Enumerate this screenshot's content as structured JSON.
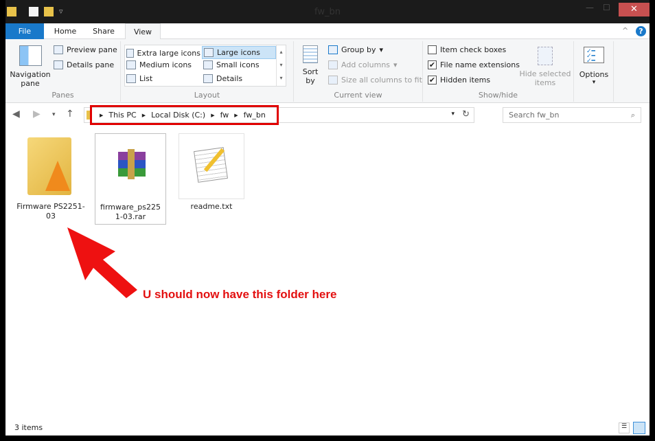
{
  "window": {
    "title": "fw_bn",
    "close": "✕",
    "minimize": "—",
    "maximize": "☐"
  },
  "tabs": [
    "File",
    "Home",
    "Share",
    "View"
  ],
  "ribbon": {
    "panes": {
      "label": "Panes",
      "navigation_pane": "Navigation pane",
      "preview_pane": "Preview pane",
      "details_pane": "Details pane"
    },
    "layout": {
      "label": "Layout",
      "items": [
        "Extra large icons",
        "Large icons",
        "Medium icons",
        "Small icons",
        "List",
        "Details"
      ],
      "selected": "Large icons"
    },
    "current_view": {
      "label": "Current view",
      "sort_by": "Sort by",
      "group_by": "Group by",
      "add_columns": "Add columns",
      "size_columns": "Size all columns to fit"
    },
    "show_hide": {
      "label": "Show/hide",
      "item_check_boxes": "Item check boxes",
      "file_name_extensions": "File name extensions",
      "hidden_items": "Hidden items",
      "hide_selected": "Hide selected items",
      "checked": {
        "item_check_boxes": false,
        "file_name_extensions": true,
        "hidden_items": true
      }
    },
    "options": "Options"
  },
  "address": {
    "crumbs": [
      "This PC",
      "Local Disk (C:)",
      "fw",
      "fw_bn"
    ],
    "search_placeholder": "Search fw_bn"
  },
  "files": [
    {
      "name": "Firmware PS2251-03",
      "type": "folder"
    },
    {
      "name": "firmware_ps2251-03.rar",
      "type": "rar",
      "selected": true
    },
    {
      "name": "readme.txt",
      "type": "txt"
    }
  ],
  "annotation": "U should now have this folder here",
  "status": {
    "count": "3 items"
  },
  "colors": {
    "accent": "#1979ca",
    "annotation": "#e31010",
    "close": "#c75050"
  }
}
